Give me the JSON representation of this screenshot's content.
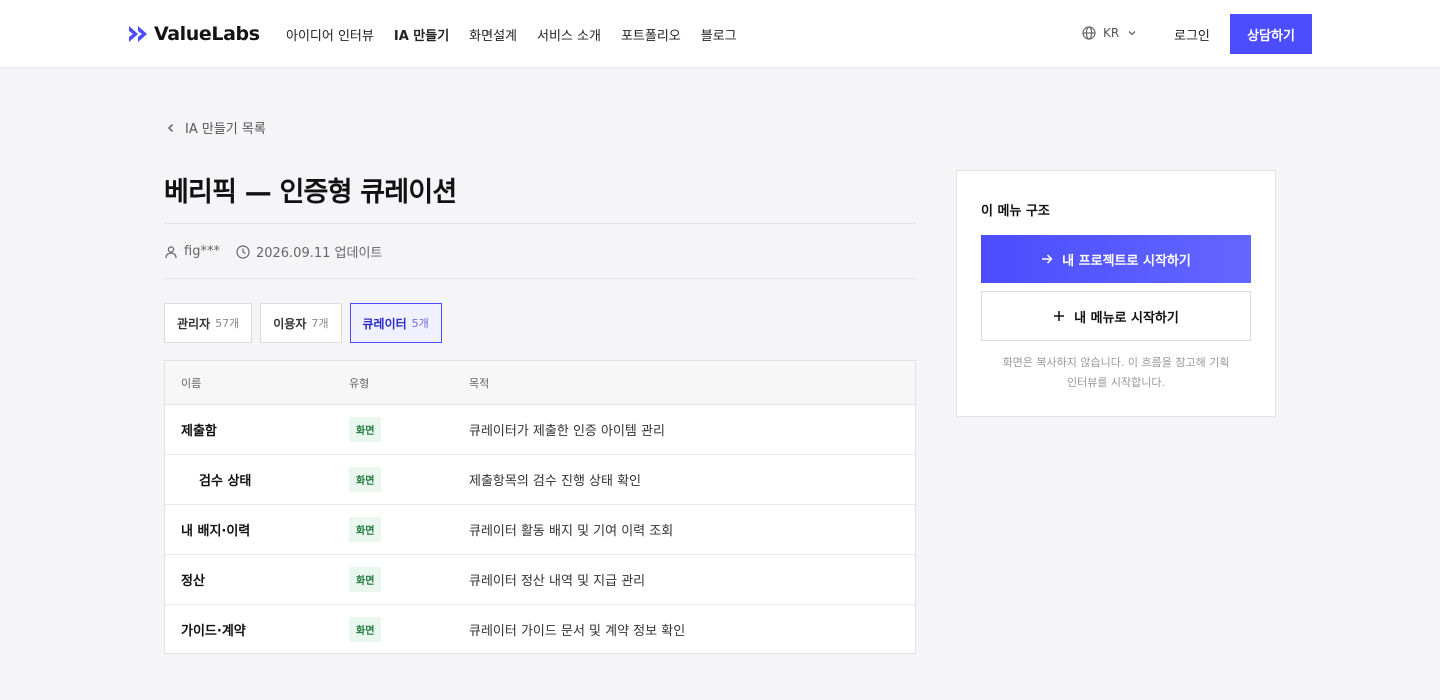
{
  "header": {
    "logo_text": "ValueLabs",
    "logo_color": "#4b4dff",
    "nav": [
      "아이디어 인터뷰",
      "IA 만들기",
      "화면설계",
      "서비스 소개",
      "포트폴리오",
      "블로그"
    ],
    "active_nav": "IA 만들기",
    "lang_label": "KR",
    "login_label": "로그인",
    "consult_label": "상담하기"
  },
  "back_link": "IA 만들기 목록",
  "title": "베리픽 — 인증형 큐레이션",
  "meta": {
    "author": "fig***",
    "updated": "2026.09.11 업데이트"
  },
  "tabs": [
    {
      "label": "관리자",
      "count": "57개",
      "active": false
    },
    {
      "label": "이용자",
      "count": "7개",
      "active": false
    },
    {
      "label": "큐레이터",
      "count": "5개",
      "active": true
    }
  ],
  "table": {
    "headers": [
      "이름",
      "유형",
      "목적"
    ],
    "rows": [
      {
        "name": "제출함",
        "type": "화면",
        "purpose": "큐레이터가 제출한 인증 아이템 관리"
      },
      {
        "name": "검수 상태",
        "type": "화면",
        "purpose": "제출항목의 검수 진행 상태 확인"
      },
      {
        "name": "내 배지·이력",
        "type": "화면",
        "purpose": "큐레이터 활동 배지 및 기여 이력 조회"
      },
      {
        "name": "정산",
        "type": "화면",
        "purpose": "큐레이터 정산 내역 및 지급 관리"
      },
      {
        "name": "가이드·계약",
        "type": "화면",
        "purpose": "큐레이터 가이드 문서 및 계약 정보 확인"
      }
    ]
  },
  "sidebar": {
    "title": "이 메뉴 구조",
    "primary_label": "내 프로젝트로 시작하기",
    "secondary_label": "내 메뉴로 시작하기",
    "note_line1": "화면은 복사하지 않습니다. 이 흐름을 참고해 기획",
    "note_line2": "인터뷰를 시작합니다."
  },
  "colors": {
    "accent": "#4b4dff",
    "badge_bg": "#eaf7ee",
    "badge_text": "#207a3e"
  }
}
